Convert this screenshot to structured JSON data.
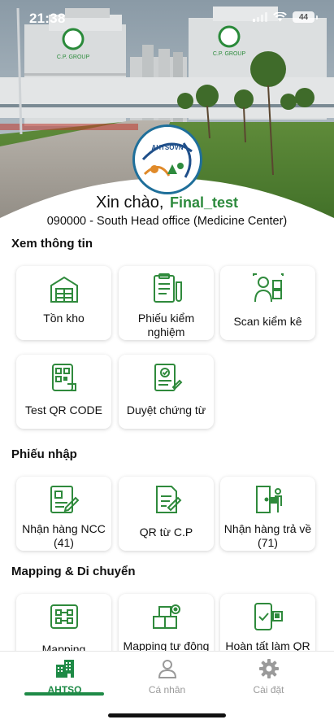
{
  "status_bar": {
    "time": "21:38",
    "battery": "44"
  },
  "hero": {
    "logo_text": "AHTSOVN",
    "building_sign": "C.P. GROUP"
  },
  "greeting": {
    "prefix": "Xin chào,",
    "username": "Final_test",
    "branch": "090000 - South Head office (Medicine Center)"
  },
  "sections": [
    {
      "title": "Xem thông tin",
      "items": [
        {
          "label": "Tồn kho",
          "icon": "warehouse-icon"
        },
        {
          "label": "Phiếu kiểm nghiệm",
          "icon": "test-report-icon"
        },
        {
          "label": "Scan kiểm kê",
          "icon": "inventory-scan-icon"
        },
        {
          "label": "Test QR CODE",
          "icon": "qr-code-icon"
        },
        {
          "label": "Duyệt chứng từ",
          "icon": "approve-document-icon"
        }
      ]
    },
    {
      "title": "Phiếu nhập",
      "items": [
        {
          "label": "Nhận hàng NCC (41)",
          "icon": "supplier-receipt-icon"
        },
        {
          "label": "QR từ C.P",
          "icon": "qr-from-cp-icon"
        },
        {
          "label": "Nhận hàng trả về (71)",
          "icon": "return-goods-icon"
        }
      ]
    },
    {
      "title": "Mapping & Di chuyển",
      "items": [
        {
          "label": "Mapping",
          "icon": "mapping-icon"
        },
        {
          "label": "Mapping tự động",
          "icon": "auto-mapping-icon"
        },
        {
          "label": "Hoàn tất làm QR",
          "icon": "complete-qr-icon"
        }
      ]
    }
  ],
  "tabbar": {
    "tabs": [
      {
        "label": "AHTSO",
        "icon": "building-icon",
        "active": true
      },
      {
        "label": "Cá nhân",
        "icon": "person-icon",
        "active": false
      },
      {
        "label": "Cài đặt",
        "icon": "gear-icon",
        "active": false
      }
    ]
  },
  "colors": {
    "brand_green": "#1e8a46",
    "username_green": "#2e8b3e",
    "icon_green": "#2f8a3c"
  }
}
